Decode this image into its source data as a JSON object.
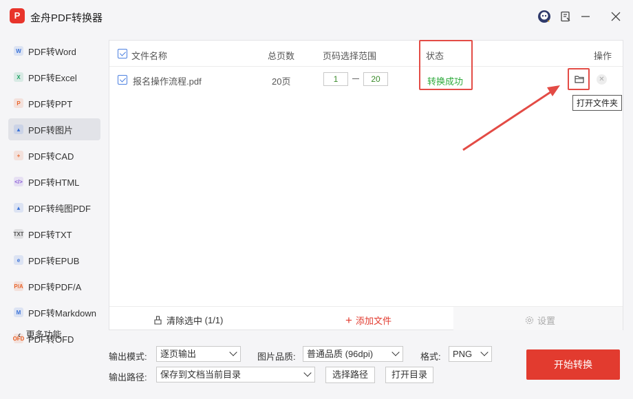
{
  "app": {
    "title": "金舟PDF转换器",
    "logo_text": "P"
  },
  "titlebar_icons": [
    "user-avatar-icon",
    "feedback-icon",
    "minimize-icon",
    "close-icon"
  ],
  "sidebar": {
    "items": [
      {
        "label": "PDF转Word",
        "icon": "word-icon",
        "color": "#3b73d8",
        "glyph": "W"
      },
      {
        "label": "PDF转Excel",
        "icon": "excel-icon",
        "color": "#21a366",
        "glyph": "X"
      },
      {
        "label": "PDF转PPT",
        "icon": "ppt-icon",
        "color": "#e8642b",
        "glyph": "P"
      },
      {
        "label": "PDF转图片",
        "icon": "image-icon",
        "color": "#3b73d8",
        "glyph": "▲",
        "active": true
      },
      {
        "label": "PDF转CAD",
        "icon": "cad-icon",
        "color": "#e8642b",
        "glyph": "+"
      },
      {
        "label": "PDF转HTML",
        "icon": "html-icon",
        "color": "#8a5bd6",
        "glyph": "</>"
      },
      {
        "label": "PDF转纯图PDF",
        "icon": "pure-image-pdf-icon",
        "color": "#3b73d8",
        "glyph": "▲"
      },
      {
        "label": "PDF转TXT",
        "icon": "txt-icon",
        "color": "#555555",
        "glyph": "TXT"
      },
      {
        "label": "PDF转EPUB",
        "icon": "epub-icon",
        "color": "#3b73d8",
        "glyph": "e"
      },
      {
        "label": "PDF转PDF/A",
        "icon": "pdfa-icon",
        "color": "#e8642b",
        "glyph": "P/A"
      },
      {
        "label": "PDF转Markdown",
        "icon": "markdown-icon",
        "color": "#3b73d8",
        "glyph": "M"
      },
      {
        "label": "PDF转OFD",
        "icon": "ofd-icon",
        "color": "#e8642b",
        "glyph": "OFD"
      }
    ],
    "more_label": "更多功能"
  },
  "table": {
    "headers": {
      "name": "文件名称",
      "pages": "总页数",
      "range": "页码选择范围",
      "status": "状态",
      "actions": "操作"
    },
    "rows": [
      {
        "name": "报名操作流程.pdf",
        "pages": "20页",
        "range_start": "1",
        "range_end": "20",
        "status": "转换成功"
      }
    ],
    "tooltip": "打开文件夹"
  },
  "bottom_bar": {
    "clear_label": "清除选中",
    "clear_count": "(1/1)",
    "add_label": "添加文件",
    "settings_label": "设置"
  },
  "options": {
    "mode_label": "输出模式:",
    "mode_value": "逐页输出",
    "quality_label": "图片品质:",
    "quality_value": "普通品质 (96dpi)",
    "format_label": "格式:",
    "format_value": "PNG",
    "path_label": "输出路径:",
    "path_value": "保存到文档当前目录",
    "choose_path_label": "选择路径",
    "open_dir_label": "打开目录"
  },
  "start_button": "开始转换",
  "colors": {
    "accent_red": "#e23b2f",
    "success_green": "#2eaa3c",
    "checkbox_blue": "#4a7fe0"
  }
}
